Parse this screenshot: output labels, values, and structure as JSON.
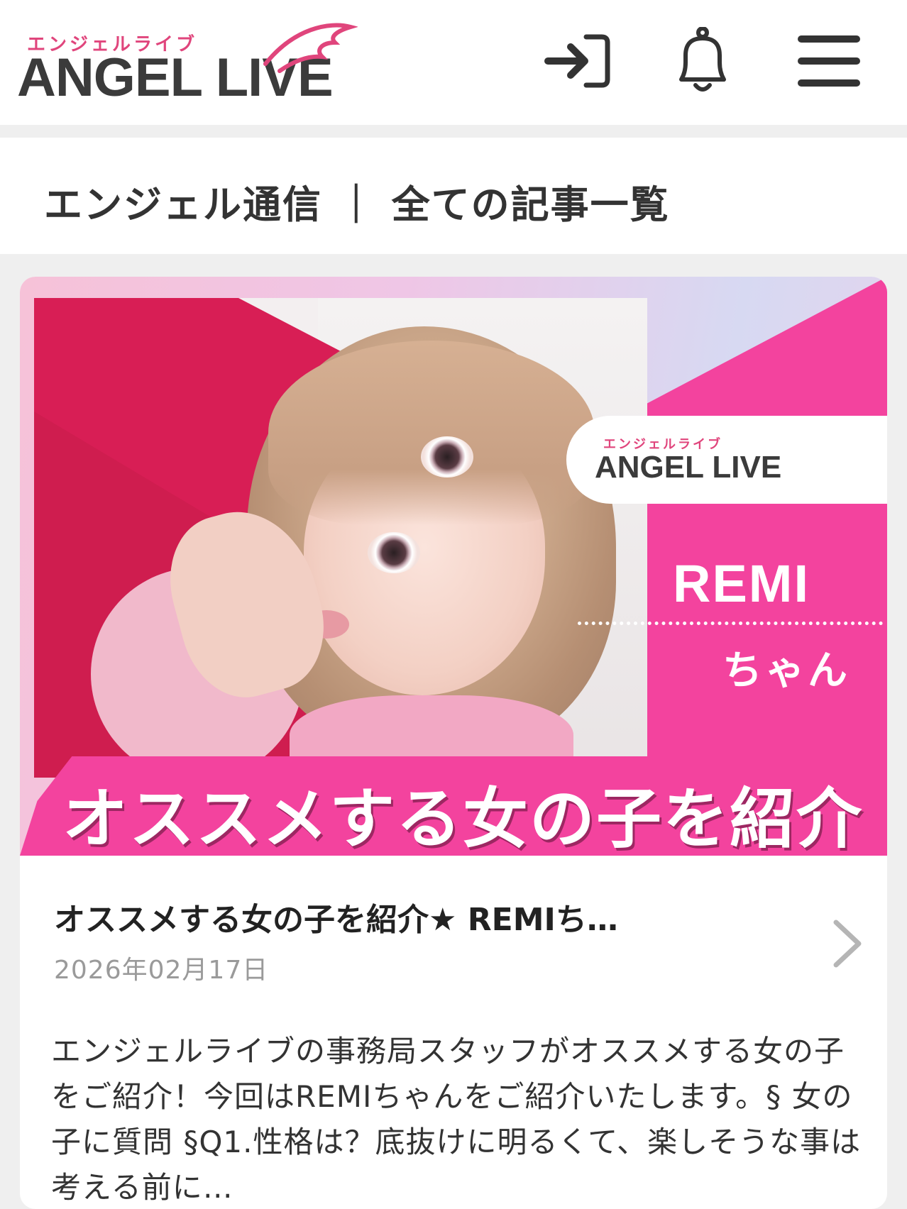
{
  "header": {
    "logo_kana": "エンジェルライブ",
    "logo_text": "ANGEL LIVE",
    "icons": [
      "login-icon",
      "bell-icon",
      "menu-icon"
    ]
  },
  "section": {
    "title": "エンジェル通信 ｜ 全ての記事一覧"
  },
  "article": {
    "banner": {
      "logo_kana": "エンジェルライブ",
      "logo_text": "ANGEL LIVE",
      "name": "REMI",
      "honorific": "ちゃん",
      "strip_text": "オススメする女の子を紹介"
    },
    "title": "オススメする女の子を紹介★ REMIち…",
    "date": "2026年02月17日",
    "excerpt": "エンジェルライブの事務局スタッフがオススメする女の子をご紹介！今回はREMIちゃんをご紹介いたします。§ 女の子に質問 §Q1.性格は？底抜けに明るくて、楽しそうな事は考える前に…"
  },
  "colors": {
    "brand_pink": "#f3439e",
    "logo_pink": "#e0457c",
    "text_dark": "#333333",
    "date_gray": "#9a9a9a"
  }
}
